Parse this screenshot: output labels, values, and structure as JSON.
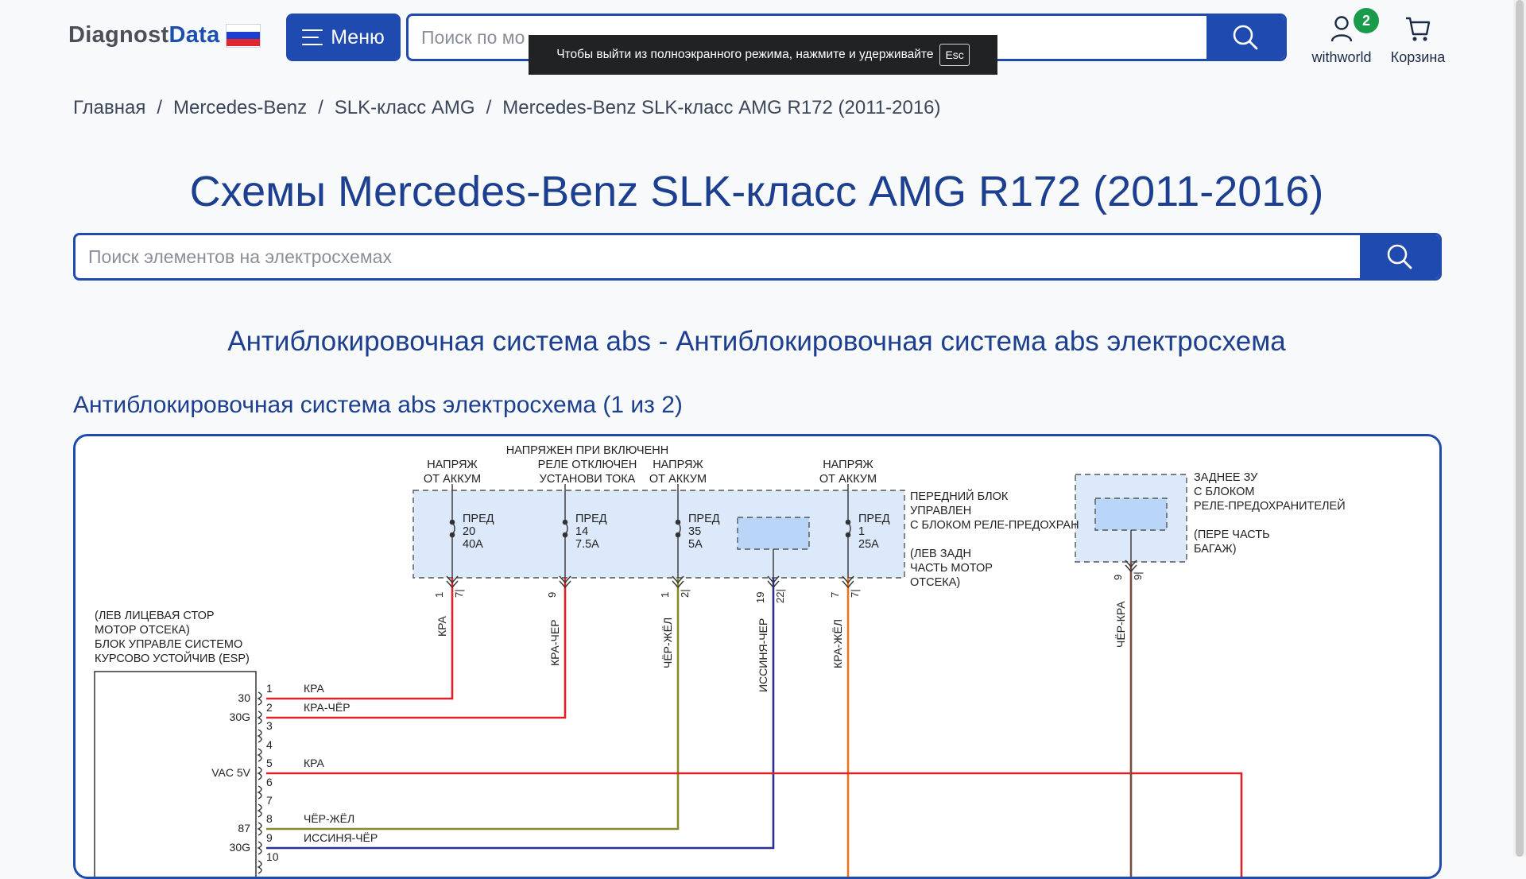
{
  "header": {
    "logo_part1": "Diagnost",
    "logo_part2": "Data",
    "flag_colors": [
      "#ffffff",
      "#1c3fd0",
      "#e0262e"
    ],
    "menu_label": "Меню",
    "search_placeholder": "Поиск по мо",
    "user_label": "withworld",
    "user_badge": "2",
    "cart_label": "Корзина"
  },
  "fullscreen_toast": {
    "text": "Чтобы выйти из полноэкранного режима, нажмите и удерживайте",
    "key": "Esc"
  },
  "breadcrumbs": [
    "Главная",
    "Mercedes-Benz",
    "SLK-класс AMG",
    "Mercedes-Benz SLK-класс AMG R172 (2011-2016)"
  ],
  "breadcrumb_separator": "/",
  "page_title": "Схемы Mercedes-Benz SLK-класс AMG R172 (2011-2016)",
  "element_search_placeholder": "Поиск элементов на электросхемах",
  "section_title": "Антиблокировочная система abs - Антиблокировочная система abs электросхема",
  "diagram_title": "Антиблокировочная система abs электросхема (1 из 2)",
  "colors": {
    "accent": "#1f4bb0",
    "title": "#1c3f8f",
    "badge": "#1a9b4b",
    "fuse_box_fill": "#dbe9fb",
    "wire_red": "#d8232a",
    "wire_olive": "#8a8a2a",
    "wire_blue": "#2b2f8f",
    "wire_orange": "#e8741e",
    "wire_brown": "#7a4a3a"
  },
  "schematic": {
    "supply_labels": [
      {
        "lines": [
          "НАПРЯЖ",
          "ОТ АККУМ"
        ]
      },
      {
        "lines": [
          "НАПРЯЖЕН ПРИ ВКЛЮЧЕНН",
          "РЕЛЕ ОТКЛЮЧЕН",
          "УСТАНОВИ ТОКА"
        ]
      },
      {
        "lines": [
          "НАПРЯЖ",
          "ОТ АККУМ"
        ]
      },
      {
        "lines": [
          "НАПРЯЖ",
          "ОТ АККУМ"
        ]
      }
    ],
    "fuses": [
      {
        "lines": [
          "ПРЕД",
          "20",
          "40A"
        ]
      },
      {
        "lines": [
          "ПРЕД",
          "14",
          "7.5A"
        ]
      },
      {
        "lines": [
          "ПРЕД",
          "35",
          "5A"
        ]
      },
      {
        "lines": [
          "ПРЕД",
          "1",
          "25A"
        ]
      }
    ],
    "front_box_label": [
      "ПЕРЕДНИЙ БЛОК",
      "УПРАВЛЕН",
      "С БЛОКОМ РЕЛЕ-ПРЕДОХРАН",
      "",
      "(ЛЕВ ЗАДН",
      "ЧАСТЬ МОТОР",
      "ОТСЕКА)"
    ],
    "rear_box_label": [
      "ЗАДНЕЕ ЗУ",
      "С БЛОКОМ",
      "РЕЛЕ-ПРЕДОХРАНИТЕЛЕЙ",
      "",
      "(ПЕРЕ ЧАСТЬ",
      "БАГАЖ)"
    ],
    "esp_label": [
      "(ЛЕВ ЛИЦЕВАЯ СТОР",
      "МОТОР ОТСЕКА)",
      "БЛОК УПРАВЛЕ СИСТЕМО",
      "КУРСОВО УСТОЙЧИВ (ESP)"
    ],
    "pin_pairs": [
      {
        "a": "1",
        "b": "7|"
      },
      {
        "a": "9",
        "b": ""
      },
      {
        "a": "1",
        "b": "2|"
      },
      {
        "a": "19",
        "b": "22|"
      },
      {
        "a": "7",
        "b": "7|"
      },
      {
        "a": "9",
        "b": "9|"
      }
    ],
    "vertical_wire_labels": [
      "КРА",
      "КРА-ЧЕР",
      "ЧЁР-ЖЁЛ",
      "ИССИНЯ-ЧЕР",
      "КРА-ЖЁЛ",
      "ЧЁР-КРА"
    ],
    "esp_pins": [
      {
        "num": "1",
        "side": "30",
        "wire": "КРА"
      },
      {
        "num": "2",
        "side": "30G",
        "wire": "КРА-ЧЁР"
      },
      {
        "num": "3",
        "side": "",
        "wire": ""
      },
      {
        "num": "4",
        "side": "",
        "wire": ""
      },
      {
        "num": "5",
        "side": "VAC 5V",
        "wire": "КРА"
      },
      {
        "num": "6",
        "side": "",
        "wire": ""
      },
      {
        "num": "7",
        "side": "",
        "wire": ""
      },
      {
        "num": "8",
        "side": "87",
        "wire": "ЧЁР-ЖЁЛ"
      },
      {
        "num": "9",
        "side": "30G",
        "wire": "ИССИНЯ-ЧЁР"
      },
      {
        "num": "10",
        "side": "",
        "wire": ""
      }
    ]
  }
}
